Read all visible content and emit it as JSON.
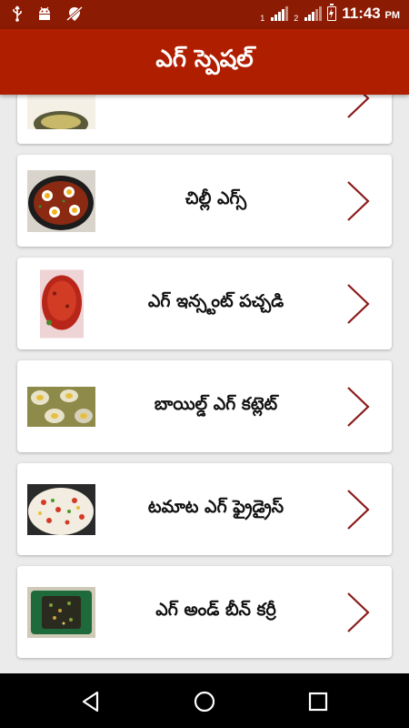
{
  "status_bar": {
    "icons_left": [
      "usb-icon",
      "android-icon",
      "no-location-icon"
    ],
    "sim1": "1",
    "sim2": "2",
    "time": "11:43",
    "ampm": "PM"
  },
  "app_bar": {
    "title": "ఎగ్ స్పెషల్"
  },
  "list": {
    "items": [
      {
        "label": "",
        "thumb": "partial-dish"
      },
      {
        "label": "చిల్లీ ఎగ్స్",
        "thumb": "skillet-eggs"
      },
      {
        "label": "ఎగ్ ఇన్స్టంట్ పచ్చడి",
        "thumb": "red-pickle"
      },
      {
        "label": "బాయిల్డ్ ఎగ్ కట్లెట్",
        "thumb": "egg-cutlet"
      },
      {
        "label": "టమాట ఎగ్ ఫ్రైడ్రైస్",
        "thumb": "fried-rice"
      },
      {
        "label": "ఎగ్ అండ్ బీన్ కర్రీ",
        "thumb": "bean-curry"
      }
    ]
  },
  "colors": {
    "status_bar": "#8c1b03",
    "app_bar": "#b01e00",
    "chevron": "#8b1a1a",
    "background": "#ebebeb"
  },
  "nav_bar": {
    "buttons": [
      "back-icon",
      "home-icon",
      "recents-icon"
    ]
  }
}
